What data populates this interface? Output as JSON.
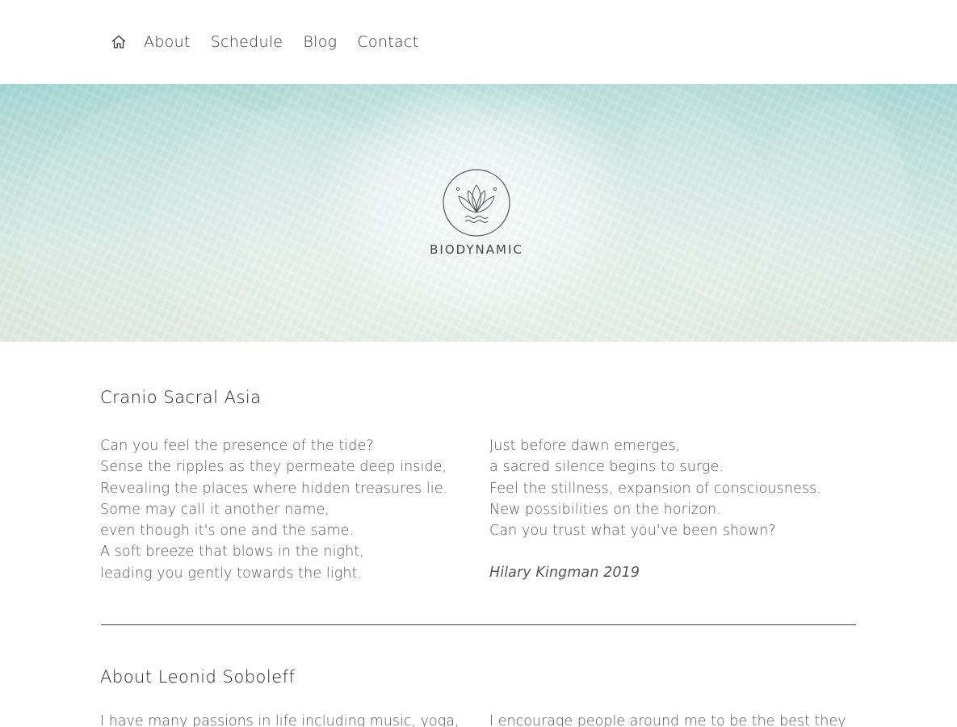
{
  "nav": {
    "home_icon": "home-icon",
    "links": [
      "About",
      "Schedule",
      "Blog",
      "Contact"
    ]
  },
  "hero": {
    "logo_icon": "lotus-icon",
    "logo_text": "BIODYNAMIC"
  },
  "section1": {
    "title": "Cranio Sacral Asia",
    "poem_left": [
      "Can you feel the presence of the tide?",
      "Sense the ripples as they permeate deep inside,",
      "Revealing the places where hidden treasures lie.",
      "Some may call it another name,",
      "even though it's one and the same.",
      "A soft breeze that blows in the night,",
      "leading you gently towards the light."
    ],
    "poem_right": [
      "Just before dawn emerges,",
      "a sacred silence begins to surge.",
      "Feel the stillness, expansion of consciousness.",
      "New possibilities on the horizon.",
      "Can you trust what you've been shown?"
    ],
    "signature": "Hilary Kingman 2019"
  },
  "section2": {
    "title": "About Leonid Soboleff",
    "left_text": "I have many passions in life including music, yoga,",
    "right_text": "I encourage people around me to be the best they"
  },
  "colors": {
    "text_dark": "#222222",
    "text_body": "#555555",
    "divider": "#444444"
  }
}
